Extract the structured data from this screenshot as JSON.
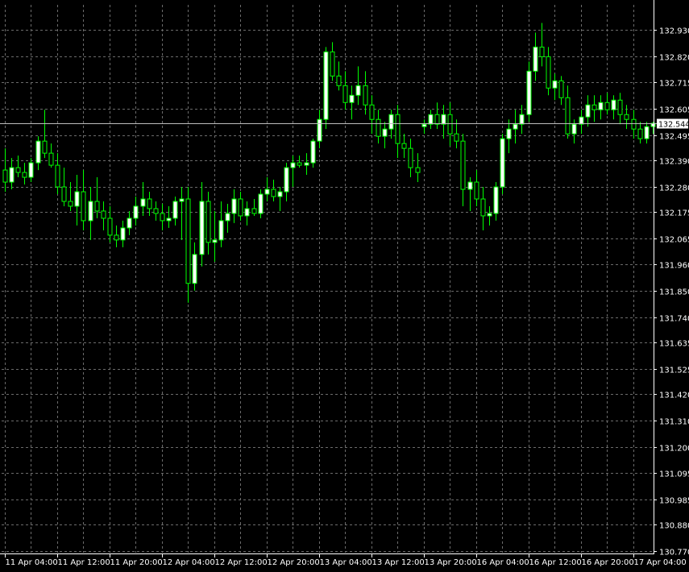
{
  "chart_data": {
    "type": "candlestick",
    "grid": true,
    "colors": {
      "background": "#000000",
      "candle": "#00ff00",
      "bull_body": "#ffffff",
      "bear_body": "#000000",
      "grid": "#6b6b6b",
      "axis": "#ffffff",
      "price_line": "#bdbdbd"
    },
    "ylim": [
      130.77,
      132.985
    ],
    "y_ticks": [
      "132.930",
      "132.820",
      "132.715",
      "132.605",
      "132.495",
      "132.390",
      "132.280",
      "132.175",
      "132.065",
      "131.960",
      "131.850",
      "131.740",
      "131.635",
      "131.525",
      "131.420",
      "131.310",
      "131.200",
      "131.095",
      "130.985",
      "130.880",
      "130.770"
    ],
    "current_price": "132.544",
    "x_labels": [
      {
        "label": "11 Apr 04:00",
        "bar": 0
      },
      {
        "label": "11 Apr 12:00",
        "bar": 8
      },
      {
        "label": "11 Apr 20:00",
        "bar": 16
      },
      {
        "label": "12 Apr 04:00",
        "bar": 24
      },
      {
        "label": "12 Apr 12:00",
        "bar": 32
      },
      {
        "label": "12 Apr 20:00",
        "bar": 40
      },
      {
        "label": "13 Apr 04:00",
        "bar": 48
      },
      {
        "label": "13 Apr 12:00",
        "bar": 56
      },
      {
        "label": "13 Apr 20:00",
        "bar": 64
      },
      {
        "label": "16 Apr 04:00",
        "bar": 72
      },
      {
        "label": "16 Apr 12:00",
        "bar": 80
      },
      {
        "label": "16 Apr 20:00",
        "bar": 88
      },
      {
        "label": "17 Apr 04:00",
        "bar": 96
      }
    ],
    "ohlc": [
      [
        132.35,
        132.44,
        132.26,
        132.3
      ],
      [
        132.3,
        132.4,
        132.27,
        132.36
      ],
      [
        132.36,
        132.41,
        132.32,
        132.34
      ],
      [
        132.34,
        132.38,
        132.29,
        132.32
      ],
      [
        132.32,
        132.4,
        132.3,
        132.38
      ],
      [
        132.38,
        132.49,
        132.35,
        132.47
      ],
      [
        132.47,
        132.6,
        132.4,
        132.42
      ],
      [
        132.42,
        132.46,
        132.36,
        132.37
      ],
      [
        132.37,
        132.42,
        132.25,
        132.28
      ],
      [
        132.28,
        132.36,
        132.2,
        132.22
      ],
      [
        132.22,
        132.3,
        132.18,
        132.2
      ],
      [
        132.2,
        132.33,
        132.12,
        132.26
      ],
      [
        132.26,
        132.35,
        132.1,
        132.14
      ],
      [
        132.14,
        132.28,
        132.06,
        132.22
      ],
      [
        132.22,
        132.32,
        132.15,
        132.18
      ],
      [
        132.18,
        132.22,
        132.1,
        132.15
      ],
      [
        132.15,
        132.2,
        132.05,
        132.08
      ],
      [
        132.08,
        132.12,
        132.03,
        132.06
      ],
      [
        132.06,
        132.14,
        132.03,
        132.11
      ],
      [
        132.11,
        132.18,
        132.08,
        132.15
      ],
      [
        132.15,
        132.24,
        132.12,
        132.2
      ],
      [
        132.2,
        132.3,
        132.16,
        132.23
      ],
      [
        132.23,
        132.26,
        132.16,
        132.19
      ],
      [
        132.19,
        132.22,
        132.14,
        132.17
      ],
      [
        132.17,
        132.21,
        132.1,
        132.14
      ],
      [
        132.14,
        132.2,
        132.11,
        132.15
      ],
      [
        132.15,
        132.24,
        132.12,
        132.22
      ],
      [
        132.22,
        132.28,
        132.06,
        132.23
      ],
      [
        132.23,
        132.28,
        131.8,
        131.88
      ],
      [
        131.88,
        132.05,
        131.85,
        132.0
      ],
      [
        132.0,
        132.3,
        131.95,
        132.22
      ],
      [
        132.22,
        132.26,
        132.0,
        132.05
      ],
      [
        132.05,
        132.18,
        131.97,
        132.06
      ],
      [
        132.06,
        132.22,
        132.03,
        132.14
      ],
      [
        132.14,
        132.21,
        132.09,
        132.17
      ],
      [
        132.17,
        132.27,
        132.13,
        132.23
      ],
      [
        132.23,
        132.26,
        132.14,
        132.16
      ],
      [
        132.16,
        132.22,
        132.12,
        132.19
      ],
      [
        132.19,
        132.23,
        132.16,
        132.17
      ],
      [
        132.17,
        132.27,
        132.15,
        132.25
      ],
      [
        132.25,
        132.32,
        132.22,
        132.27
      ],
      [
        132.27,
        132.31,
        132.22,
        132.24
      ],
      [
        132.24,
        132.28,
        132.18,
        132.26
      ],
      [
        132.26,
        132.38,
        132.22,
        132.36
      ],
      [
        132.36,
        132.41,
        132.28,
        132.38
      ],
      [
        132.38,
        132.41,
        132.36,
        132.37
      ],
      [
        132.37,
        132.42,
        132.33,
        132.38
      ],
      [
        132.38,
        132.48,
        132.36,
        132.47
      ],
      [
        132.47,
        132.6,
        132.44,
        132.56
      ],
      [
        132.56,
        132.86,
        132.52,
        132.84
      ],
      [
        132.84,
        132.88,
        132.72,
        132.74
      ],
      [
        132.74,
        132.8,
        132.68,
        132.7
      ],
      [
        132.7,
        132.76,
        132.6,
        132.63
      ],
      [
        132.63,
        132.7,
        132.56,
        132.66
      ],
      [
        132.66,
        132.78,
        132.62,
        132.7
      ],
      [
        132.7,
        132.76,
        132.58,
        132.62
      ],
      [
        132.62,
        132.66,
        132.5,
        132.56
      ],
      [
        132.56,
        132.6,
        132.46,
        132.49
      ],
      [
        132.49,
        132.55,
        132.44,
        132.52
      ],
      [
        132.52,
        132.6,
        132.48,
        132.58
      ],
      [
        132.58,
        132.62,
        132.4,
        132.46
      ],
      [
        132.46,
        132.5,
        132.4,
        132.44
      ],
      [
        132.44,
        132.48,
        132.32,
        132.36
      ],
      [
        132.36,
        132.42,
        132.3,
        132.34
      ],
      [
        132.53,
        132.56,
        132.5,
        132.54
      ],
      [
        132.54,
        132.6,
        132.52,
        132.58
      ],
      [
        132.58,
        132.63,
        132.52,
        132.54
      ],
      [
        132.54,
        132.62,
        132.48,
        132.58
      ],
      [
        132.58,
        132.63,
        132.45,
        132.5
      ],
      [
        132.5,
        132.56,
        132.44,
        132.47
      ],
      [
        132.47,
        132.5,
        132.2,
        132.27
      ],
      [
        132.27,
        132.32,
        132.18,
        132.3
      ],
      [
        132.3,
        132.35,
        132.2,
        132.23
      ],
      [
        132.23,
        132.28,
        132.1,
        132.16
      ],
      [
        132.16,
        132.2,
        132.12,
        132.17
      ],
      [
        132.17,
        132.3,
        132.14,
        132.28
      ],
      [
        132.28,
        132.5,
        132.25,
        132.48
      ],
      [
        132.48,
        132.56,
        132.42,
        132.52
      ],
      [
        132.52,
        132.6,
        132.46,
        132.54
      ],
      [
        132.54,
        132.62,
        132.5,
        132.58
      ],
      [
        132.58,
        132.8,
        132.55,
        132.76
      ],
      [
        132.76,
        132.92,
        132.72,
        132.86
      ],
      [
        132.86,
        132.96,
        132.78,
        132.82
      ],
      [
        132.82,
        132.86,
        132.66,
        132.69
      ],
      [
        132.69,
        132.75,
        132.64,
        132.72
      ],
      [
        132.72,
        132.74,
        132.62,
        132.65
      ],
      [
        132.65,
        132.7,
        132.48,
        132.5
      ],
      [
        132.5,
        132.56,
        132.46,
        132.54
      ],
      [
        132.54,
        132.6,
        132.5,
        132.57
      ],
      [
        132.57,
        132.66,
        132.53,
        132.62
      ],
      [
        132.62,
        132.66,
        132.55,
        132.6
      ],
      [
        132.6,
        132.66,
        132.56,
        132.63
      ],
      [
        132.63,
        132.67,
        132.58,
        132.6
      ],
      [
        132.6,
        132.66,
        132.56,
        132.64
      ],
      [
        132.64,
        132.67,
        132.54,
        132.58
      ],
      [
        132.58,
        132.62,
        132.52,
        132.56
      ],
      [
        132.56,
        132.6,
        132.48,
        132.52
      ],
      [
        132.52,
        132.55,
        132.46,
        132.48
      ],
      [
        132.48,
        132.55,
        132.46,
        132.53
      ],
      [
        132.53,
        132.55,
        132.5,
        132.544
      ]
    ]
  }
}
